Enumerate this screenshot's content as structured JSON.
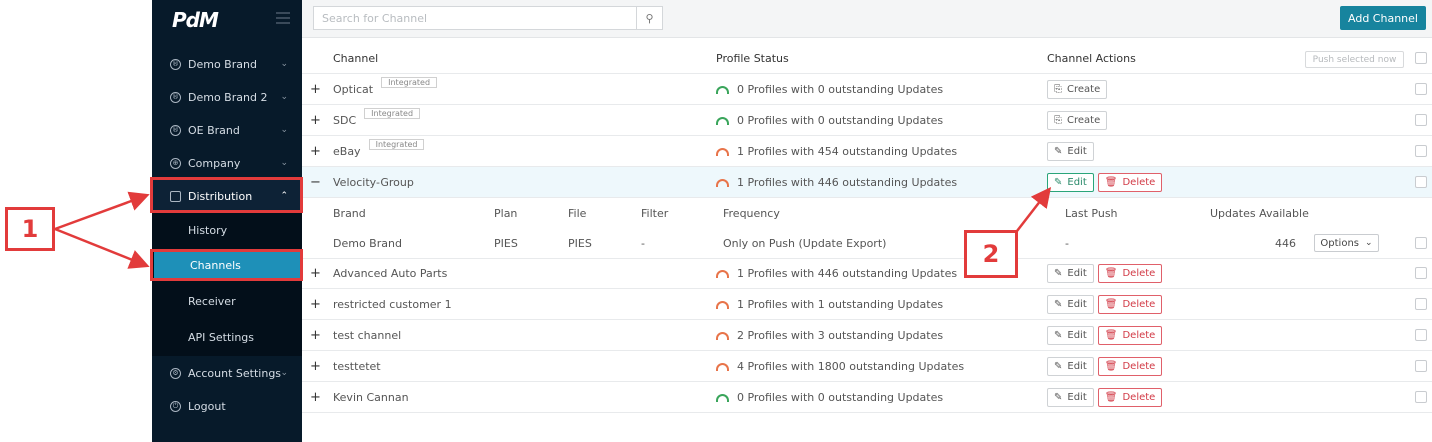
{
  "sidebar": {
    "logo": "PdM",
    "items": [
      {
        "label": "Demo Brand",
        "icon": "brand-icon"
      },
      {
        "label": "Demo Brand 2",
        "icon": "brand-icon"
      },
      {
        "label": "OE Brand",
        "icon": "brand-icon"
      },
      {
        "label": "Company",
        "icon": "globe-icon"
      },
      {
        "label": "Distribution",
        "icon": "distribution-icon"
      },
      {
        "label": "Account Settings",
        "icon": "gear-icon"
      },
      {
        "label": "Logout",
        "icon": "logout-icon"
      }
    ],
    "sub_items": [
      "History",
      "Channels",
      "Receiver",
      "API Settings"
    ]
  },
  "topbar": {
    "search_placeholder": "Search for Channel",
    "add_channel_label": "Add Channel"
  },
  "table": {
    "headers": {
      "channel": "Channel",
      "profile_status": "Profile Status",
      "channel_actions": "Channel Actions",
      "push_selected": "Push selected now"
    },
    "rows": [
      {
        "toggle": "+",
        "name": "Opticat",
        "tag": "Integrated",
        "status": "0 Profiles with 0 outstanding Updates",
        "state": "ok",
        "actions": [
          "Create"
        ]
      },
      {
        "toggle": "+",
        "name": "SDC",
        "tag": "Integrated",
        "status": "0 Profiles with 0 outstanding Updates",
        "state": "ok",
        "actions": [
          "Create"
        ]
      },
      {
        "toggle": "+",
        "name": "eBay",
        "tag": "Integrated",
        "status": "1 Profiles with 454 outstanding Updates",
        "state": "warn",
        "actions": [
          "Edit"
        ]
      },
      {
        "toggle": "−",
        "name": "Velocity-Group",
        "tag": "",
        "status": "1 Profiles with 446 outstanding Updates",
        "state": "warn",
        "actions": [
          "Edit",
          "Delete"
        ]
      },
      {
        "toggle": "+",
        "name": "Advanced Auto Parts",
        "tag": "",
        "status": "1 Profiles with 446 outstanding Updates",
        "state": "warn",
        "actions": [
          "Edit",
          "Delete"
        ]
      },
      {
        "toggle": "+",
        "name": "restricted customer 1",
        "tag": "",
        "status": "1 Profiles with 1 outstanding Updates",
        "state": "warn",
        "actions": [
          "Edit",
          "Delete"
        ]
      },
      {
        "toggle": "+",
        "name": "test channel",
        "tag": "",
        "status": "2 Profiles with 3 outstanding Updates",
        "state": "warn",
        "actions": [
          "Edit",
          "Delete"
        ]
      },
      {
        "toggle": "+",
        "name": "testtetet",
        "tag": "",
        "status": "4 Profiles with 1800 outstanding Updates",
        "state": "warn",
        "actions": [
          "Edit",
          "Delete"
        ]
      },
      {
        "toggle": "+",
        "name": "Kevin Cannan",
        "tag": "",
        "status": "0 Profiles with 0 outstanding Updates",
        "state": "ok",
        "actions": [
          "Edit",
          "Delete"
        ]
      }
    ],
    "sub_table": {
      "headers": {
        "brand": "Brand",
        "plan": "Plan",
        "file": "File",
        "filter": "Filter",
        "frequency": "Frequency",
        "last_push": "Last Push",
        "updates_available": "Updates Available"
      },
      "row": {
        "brand": "Demo Brand",
        "plan": "PIES",
        "file": "PIES",
        "filter": "-",
        "frequency": "Only on Push (Update Export)",
        "last_push": "-",
        "updates_available": "446",
        "options": "Options"
      }
    }
  },
  "callouts": {
    "one": "1",
    "two": "2"
  },
  "colors": {
    "accent": "#17849e",
    "sidebar": "#071a2a",
    "callout": "#e23b3b",
    "delete": "#d23a46",
    "ok": "#3aa55b",
    "warn": "#e8744a"
  }
}
